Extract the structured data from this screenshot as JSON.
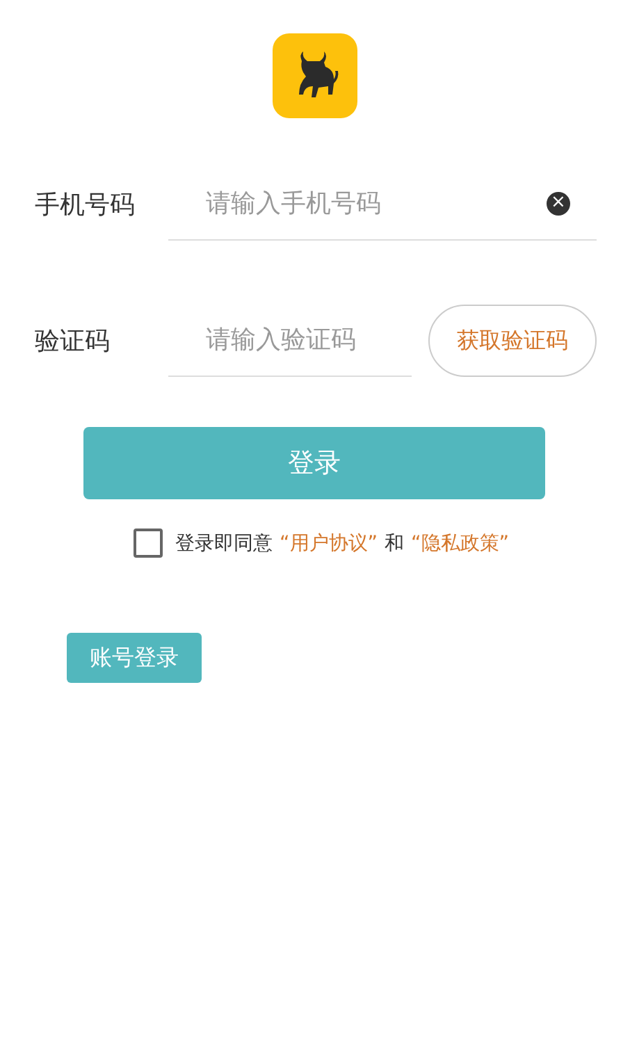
{
  "phone": {
    "label": "手机号码",
    "placeholder": "请输入手机号码",
    "clear_icon": "×"
  },
  "code": {
    "label": "验证码",
    "placeholder": "请输入验证码",
    "button": "获取验证码"
  },
  "login_button": "登录",
  "agreement": {
    "checked": false,
    "prefix": "登录即同意",
    "link_1": "“用户协议”",
    "joiner": "和",
    "link_2": "“隐私政策”"
  },
  "account_login_button": "账号登录"
}
